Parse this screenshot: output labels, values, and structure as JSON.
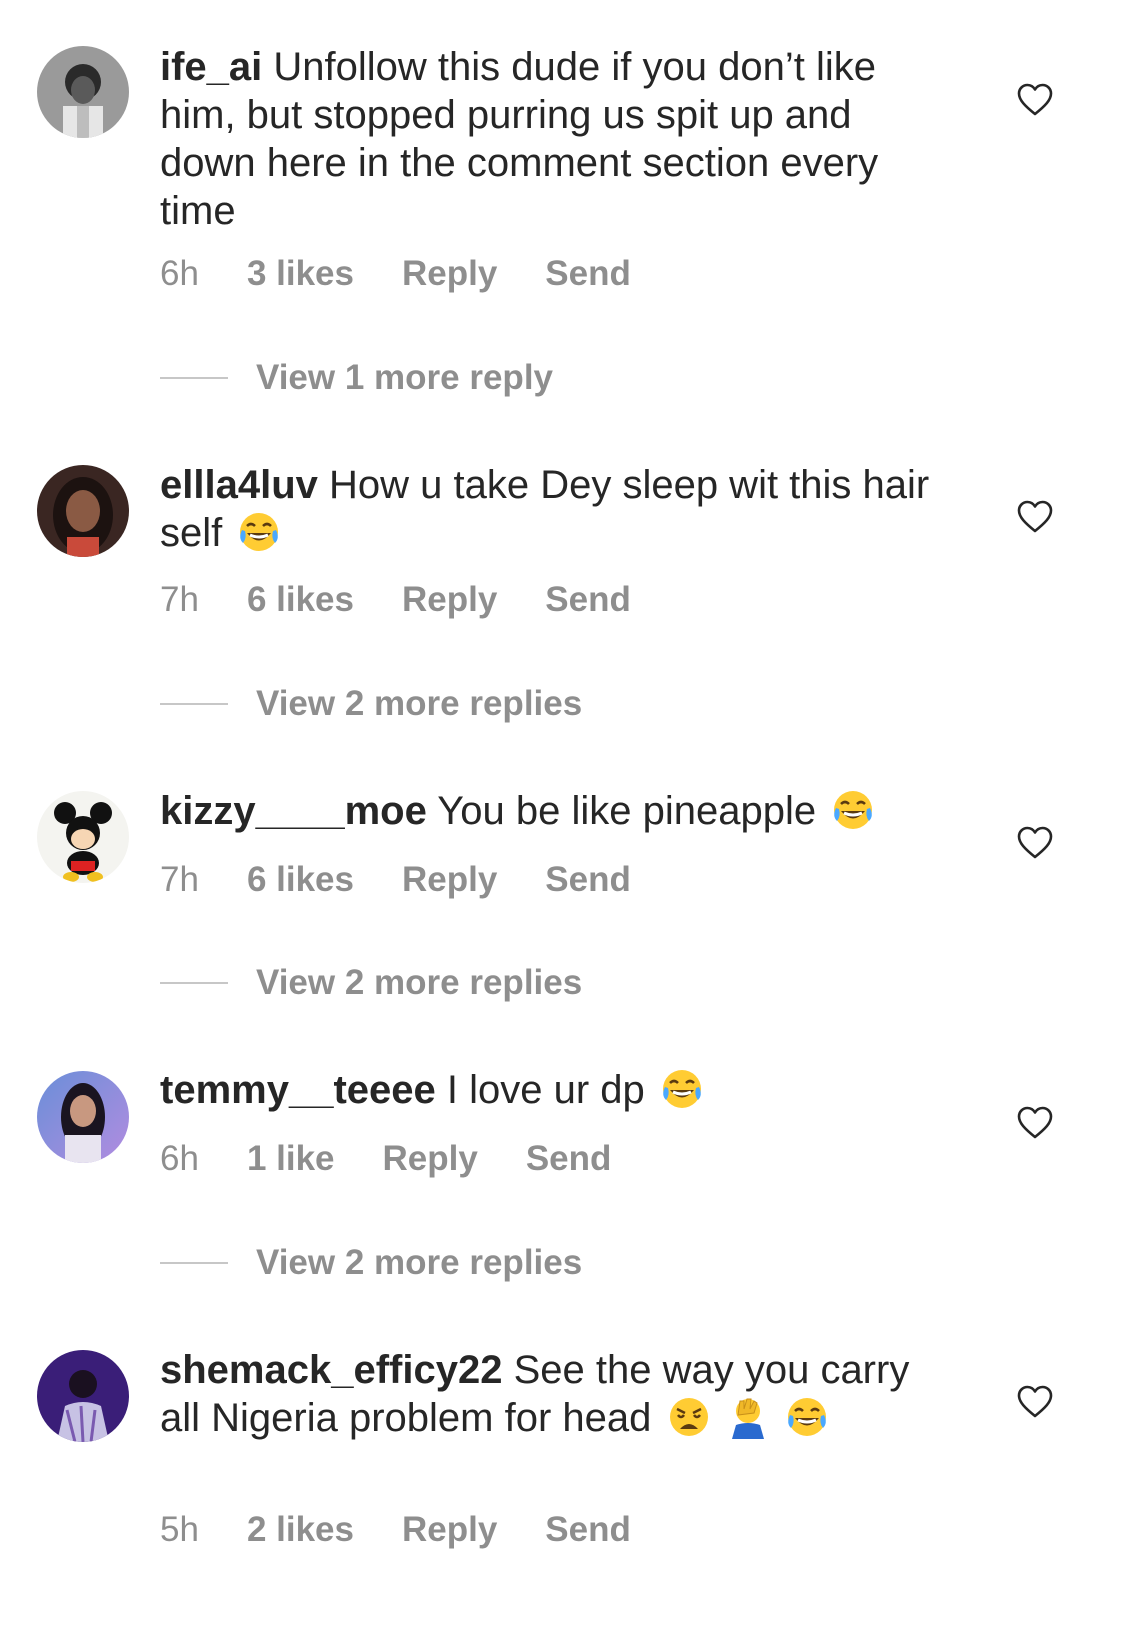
{
  "comments": [
    {
      "username": "ife_ai",
      "text": " Unfollow this dude if you don’t like him, but stopped purring us spit up and down here in the comment section every time",
      "time": "6h",
      "likes": "3 likes",
      "reply": "Reply",
      "send": "Send",
      "view_replies": "View 1 more reply",
      "emojis": []
    },
    {
      "username": "ellla4luv",
      "text": " How u take Dey sleep wit this hair self",
      "time": "7h",
      "likes": "6 likes",
      "reply": "Reply",
      "send": "Send",
      "view_replies": "View 2 more replies",
      "emojis": [
        "tears-of-joy"
      ]
    },
    {
      "username": "kizzy____moe",
      "text": " You be like pineapple",
      "time": "7h",
      "likes": "6 likes",
      "reply": "Reply",
      "send": "Send",
      "view_replies": "View 2 more replies",
      "emojis": [
        "tears-of-joy"
      ]
    },
    {
      "username": "temmy__teeee",
      "text": " I love ur dp",
      "time": "6h",
      "likes": "1 like",
      "reply": "Reply",
      "send": "Send",
      "view_replies": "View 2 more replies",
      "emojis": [
        "tears-of-joy"
      ]
    },
    {
      "username": "shemack_efficy22",
      "text": " See the way you carry all Nigeria problem for head",
      "time": "5h",
      "likes": "2 likes",
      "reply": "Reply",
      "send": "Send",
      "view_replies": "",
      "emojis": [
        "weary-face",
        "facepalm",
        "tears-of-joy"
      ]
    }
  ],
  "colors": {
    "text": "#262626",
    "meta": "#8e8e8e",
    "divider": "#c7c7c7"
  },
  "icons": {
    "like": "heart-outline-icon"
  }
}
